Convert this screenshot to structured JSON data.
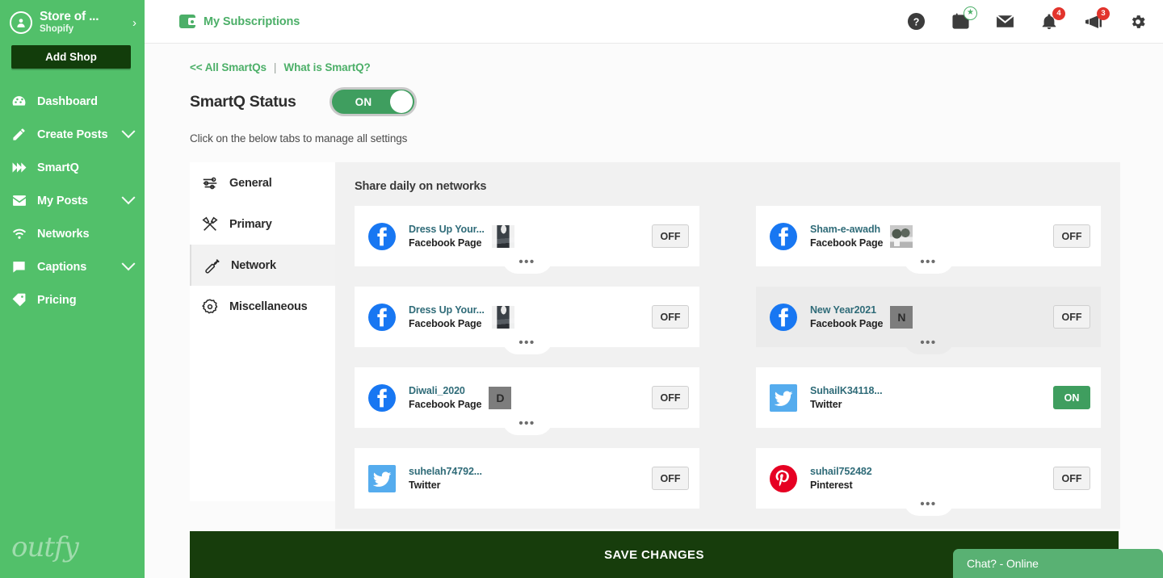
{
  "sidebar": {
    "store_name": "Store of ...",
    "store_platform": "Shopify",
    "chevron": "›",
    "add_shop_label": "Add Shop",
    "logo_text": "outfy",
    "items": [
      {
        "label": "Dashboard",
        "icon": "dashboard-icon",
        "has_caret": false
      },
      {
        "label": "Create Posts",
        "icon": "pencil-icon",
        "has_caret": true
      },
      {
        "label": "SmartQ",
        "icon": "smartq-icon",
        "has_caret": false
      },
      {
        "label": "My Posts",
        "icon": "envelope-icon",
        "has_caret": true
      },
      {
        "label": "Networks",
        "icon": "wifi-icon",
        "has_caret": false
      },
      {
        "label": "Captions",
        "icon": "chat-bubble-icon",
        "has_caret": true
      },
      {
        "label": "Pricing",
        "icon": "tag-icon",
        "has_caret": false
      }
    ]
  },
  "topbar": {
    "subscriptions_label": "My Subscriptions",
    "actions": [
      {
        "icon": "help-icon",
        "badge": ""
      },
      {
        "icon": "calendar-icon",
        "badge": "★"
      },
      {
        "icon": "mail-icon",
        "badge": ""
      },
      {
        "icon": "bell-icon",
        "badge": "4"
      },
      {
        "icon": "megaphone-icon",
        "badge": "3"
      },
      {
        "icon": "gear-icon",
        "badge": ""
      }
    ]
  },
  "breadcrumb": {
    "back_label": "<< All SmartQs",
    "separator": "|",
    "help_label": "What is SmartQ?"
  },
  "status": {
    "title": "SmartQ Status",
    "toggle_value": "ON",
    "hint": "Click on the below tabs to manage all settings"
  },
  "tabs": [
    {
      "label": "General",
      "icon": "sliders-icon",
      "active": false
    },
    {
      "label": "Primary",
      "icon": "tools-icon",
      "active": false
    },
    {
      "label": "Network",
      "icon": "wrench-icon",
      "active": true
    },
    {
      "label": "Miscellaneous",
      "icon": "cog-gear-icon",
      "active": false
    }
  ],
  "panel": {
    "title": "Share daily on networks",
    "more_glyph": "•••",
    "left_column": [
      {
        "name": "Dress Up Your...",
        "type": "Facebook Page",
        "network": "facebook",
        "status": "OFF",
        "thumb_kind": "photo-jeans",
        "thumb_letter": "",
        "shaded": false,
        "has_more": true
      },
      {
        "name": "Dress Up Your...",
        "type": "Facebook Page",
        "network": "facebook",
        "status": "OFF",
        "thumb_kind": "photo-jeans",
        "thumb_letter": "",
        "shaded": false,
        "has_more": true
      },
      {
        "name": "Diwali_2020",
        "type": "Facebook Page",
        "network": "facebook",
        "status": "OFF",
        "thumb_kind": "letter",
        "thumb_letter": "D",
        "shaded": false,
        "has_more": true
      },
      {
        "name": "suhelah74792...",
        "type": "Twitter",
        "network": "twitter",
        "status": "OFF",
        "thumb_kind": "none",
        "thumb_letter": "",
        "shaded": false,
        "has_more": false
      }
    ],
    "right_column": [
      {
        "name": "Sham-e-awadh",
        "type": "Facebook Page",
        "network": "facebook",
        "status": "OFF",
        "thumb_kind": "photo-plants",
        "thumb_letter": "",
        "shaded": false,
        "has_more": true
      },
      {
        "name": "New Year2021",
        "type": "Facebook Page",
        "network": "facebook",
        "status": "OFF",
        "thumb_kind": "letter",
        "thumb_letter": "N",
        "shaded": true,
        "has_more": true
      },
      {
        "name": "SuhailK34118...",
        "type": "Twitter",
        "network": "twitter",
        "status": "ON",
        "thumb_kind": "none",
        "thumb_letter": "",
        "shaded": false,
        "has_more": false
      },
      {
        "name": "suhail752482",
        "type": "Pinterest",
        "network": "pinterest",
        "status": "OFF",
        "thumb_kind": "none",
        "thumb_letter": "",
        "shaded": false,
        "has_more": true
      }
    ]
  },
  "savebar": {
    "label": "SAVE CHANGES"
  },
  "chat": {
    "label": "Chat? - Online"
  },
  "colors": {
    "sidebar_green": "#52c06a",
    "accent_green": "#4caf68",
    "toggle_green": "#3f9e5f",
    "dark_green": "#173d0c",
    "badge_red": "#e2342c",
    "facebook_blue": "#1877f2",
    "twitter_blue": "#55acee",
    "pinterest_red": "#e60023",
    "link_teal": "#2f6b78"
  }
}
